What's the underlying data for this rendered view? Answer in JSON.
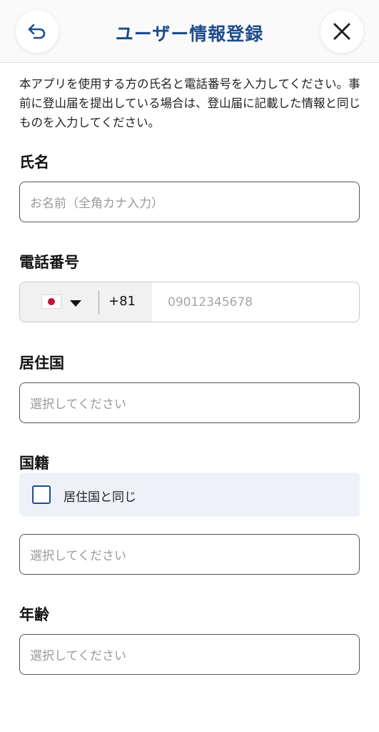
{
  "header": {
    "title": "ユーザー情報登録",
    "back_icon": "undo-arrow-icon",
    "close_icon": "close-icon"
  },
  "intro": "本アプリを使用する方の氏名と電話番号を入力してください。事前に登山届を提出している場合は、登山届に記載した情報と同じものを入力してください。",
  "name": {
    "label": "氏名",
    "placeholder": "お名前（全角カナ入力）",
    "value": ""
  },
  "phone": {
    "label": "電話番号",
    "country_flag": "japan-flag-icon",
    "dial_code": "+81",
    "placeholder": "09012345678",
    "value": ""
  },
  "residence": {
    "label": "居住国",
    "placeholder": "選択してください"
  },
  "nationality": {
    "label": "国籍",
    "same_as_residence_label": "居住国と同じ",
    "same_as_residence_checked": false,
    "placeholder": "選択してください"
  },
  "age": {
    "label": "年齢",
    "placeholder": "選択してください"
  },
  "colors": {
    "accent": "#1f4d8c",
    "checkbox_bg": "#eef2f8"
  }
}
